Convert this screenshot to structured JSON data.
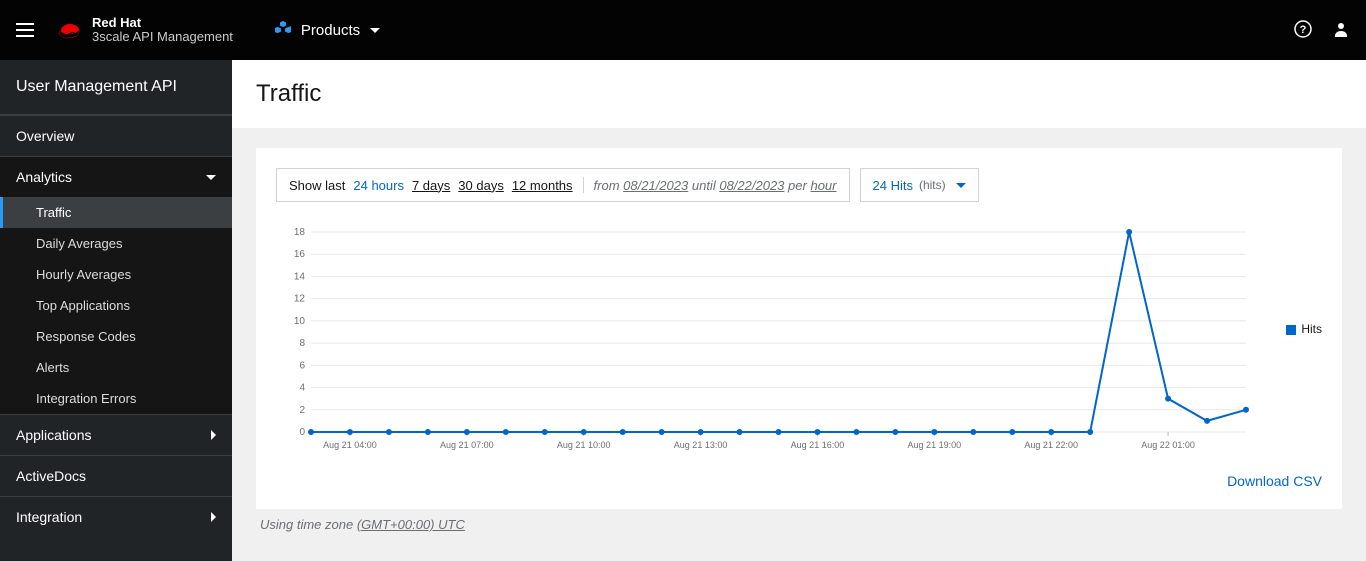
{
  "brand": {
    "line1": "Red Hat",
    "line2": "3scale API Management"
  },
  "topnav": {
    "products_label": "Products"
  },
  "sidebar": {
    "title": "User Management API",
    "items": [
      {
        "label": "Overview"
      },
      {
        "label": "Analytics",
        "expanded": true,
        "children": [
          {
            "label": "Traffic",
            "active": true
          },
          {
            "label": "Daily Averages"
          },
          {
            "label": "Hourly Averages"
          },
          {
            "label": "Top Applications"
          },
          {
            "label": "Response Codes"
          },
          {
            "label": "Alerts"
          },
          {
            "label": "Integration Errors"
          }
        ]
      },
      {
        "label": "Applications"
      },
      {
        "label": "ActiveDocs"
      },
      {
        "label": "Integration"
      }
    ]
  },
  "page": {
    "title": "Traffic"
  },
  "range": {
    "prefix": "Show last",
    "options": [
      "24 hours",
      "7 days",
      "30 days",
      "12 months"
    ],
    "active": "24 hours",
    "from_label": "from",
    "from_date": "08/21/2023",
    "until_label": "until",
    "until_date": "08/22/2023",
    "per_label": "per",
    "per_value": "hour"
  },
  "metric": {
    "value": "24 Hits",
    "sub": "(hits)"
  },
  "chart_data": {
    "type": "line",
    "title": "",
    "xlabel": "",
    "ylabel": "",
    "ylim": [
      0,
      18
    ],
    "yticks": [
      0,
      2,
      4,
      6,
      8,
      10,
      12,
      14,
      16,
      18
    ],
    "xticks": [
      "Aug 21 04:00",
      "Aug 21 07:00",
      "Aug 21 10:00",
      "Aug 21 13:00",
      "Aug 21 16:00",
      "Aug 21 19:00",
      "Aug 21 22:00",
      "Aug 22 01:00"
    ],
    "series": [
      {
        "name": "Hits",
        "color": "#0066cc",
        "x": [
          "Aug 21 03:00",
          "Aug 21 04:00",
          "Aug 21 05:00",
          "Aug 21 06:00",
          "Aug 21 07:00",
          "Aug 21 08:00",
          "Aug 21 09:00",
          "Aug 21 10:00",
          "Aug 21 11:00",
          "Aug 21 12:00",
          "Aug 21 13:00",
          "Aug 21 14:00",
          "Aug 21 15:00",
          "Aug 21 16:00",
          "Aug 21 17:00",
          "Aug 21 18:00",
          "Aug 21 19:00",
          "Aug 21 20:00",
          "Aug 21 21:00",
          "Aug 21 22:00",
          "Aug 21 23:00",
          "Aug 22 00:00",
          "Aug 22 01:00",
          "Aug 22 02:00",
          "Aug 22 03:00"
        ],
        "values": [
          0,
          0,
          0,
          0,
          0,
          0,
          0,
          0,
          0,
          0,
          0,
          0,
          0,
          0,
          0,
          0,
          0,
          0,
          0,
          0,
          0,
          18,
          3,
          1,
          2
        ]
      }
    ]
  },
  "legend": {
    "label": "Hits"
  },
  "download": {
    "label": "Download CSV"
  },
  "footer": {
    "prefix": "Using time zone",
    "tz": "(GMT+00:00) UTC"
  }
}
